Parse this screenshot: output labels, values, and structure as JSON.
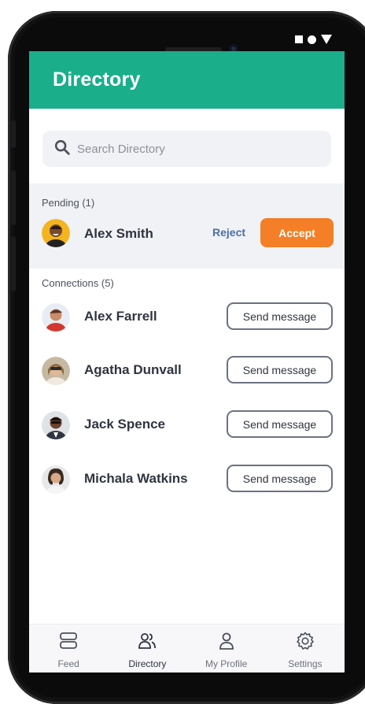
{
  "header": {
    "title": "Directory",
    "accent": "#1aae8b"
  },
  "search": {
    "placeholder": "Search Directory"
  },
  "pending": {
    "label": "Pending (1)",
    "items": [
      {
        "name": "Alex Smith",
        "reject_label": "Reject",
        "accept_label": "Accept"
      }
    ]
  },
  "connections": {
    "label": "Connections (5)",
    "items": [
      {
        "name": "Alex Farrell",
        "action_label": "Send message"
      },
      {
        "name": "Agatha Dunvall",
        "action_label": "Send message"
      },
      {
        "name": "Jack Spence",
        "action_label": "Send message"
      },
      {
        "name": "Michala Watkins",
        "action_label": "Send message"
      }
    ]
  },
  "nav": {
    "items": [
      {
        "label": "Feed",
        "icon": "feed-icon"
      },
      {
        "label": "Directory",
        "icon": "people-icon",
        "active": true
      },
      {
        "label": "My Profile",
        "icon": "person-icon"
      },
      {
        "label": "Settings",
        "icon": "gear-icon"
      }
    ]
  },
  "colors": {
    "accept": "#f47f27",
    "reject": "#4a6fa5"
  }
}
